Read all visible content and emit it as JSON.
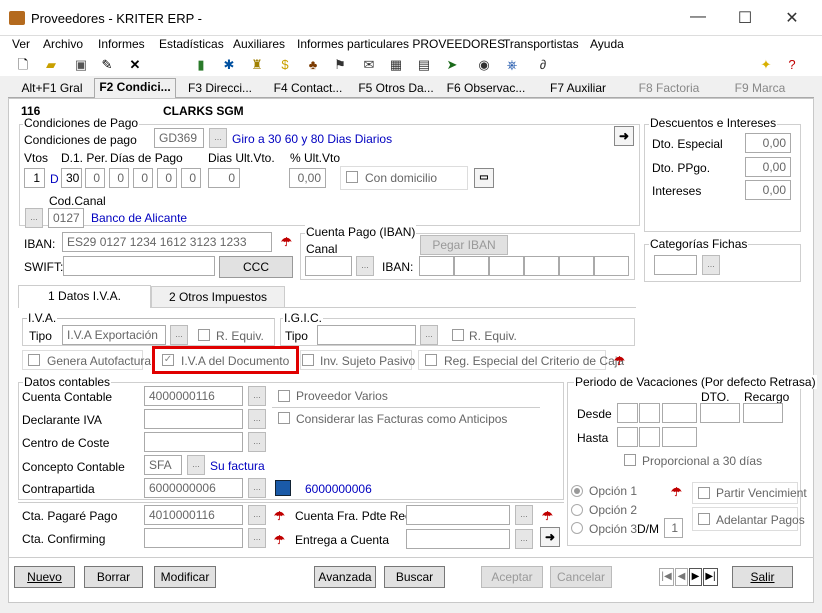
{
  "window": {
    "title": "Proveedores - KRITER ERP -"
  },
  "menu": [
    "Ver",
    "Archivo",
    "Informes",
    "Estadísticas",
    "Auxiliares",
    "Informes particulares PROVEEDORES",
    "Transportistas",
    "Ayuda"
  ],
  "tabs": [
    "Alt+F1 Gral",
    "F2 Condici...",
    "F3 Direcci...",
    "F4 Contact...",
    "F5 Otros Da...",
    "F6 Observac...",
    "F7 Auxiliar",
    "F8 Factoria",
    "F9 Marca"
  ],
  "header": {
    "code": "116",
    "name": "CLARKS SGM"
  },
  "condiciones_pago": {
    "group": "Condiciones de Pago",
    "label": "Condiciones de pago",
    "code": "GD369",
    "desc": "Giro a 30 60 y 80 Dias Diarios",
    "vtos_label": "Vtos",
    "d1per_label": "D.1. Per.",
    "dias_pago_label": "Días de Pago",
    "dias_ult_label": "Dias Ult.Vto.",
    "pct_ult_label": "% Ult.Vto",
    "vtos": "1",
    "d_flag": "D",
    "d1per": "30",
    "dias": [
      "0",
      "0",
      "0",
      "0",
      "0"
    ],
    "dias_ult": "0",
    "pct_ult": "0,00",
    "con_domicilio": "Con domicilio",
    "cod_canal_label": "Cod.Canal",
    "cod_canal": "0127",
    "banco": "Banco de Alicante",
    "iban_label": "IBAN:",
    "iban": "ES29 0127 1234 1612 3123 1233",
    "swift_label": "SWIFT:",
    "ccc": "CCC"
  },
  "cuenta_pago": {
    "group": "Cuenta Pago (IBAN)",
    "pegar": "Pegar IBAN",
    "canal_label": "Canal",
    "iban_label": "IBAN:"
  },
  "descuentos": {
    "group": "Descuentos e Intereses",
    "especial_label": "Dto. Especial",
    "especial": "0,00",
    "ppgo_label": "Dto. PPgo.",
    "ppgo": "0,00",
    "intereses_label": "Intereses",
    "intereses": "0,00"
  },
  "categorias": {
    "group": "Categorías Fichas"
  },
  "subtabs": [
    "1 Datos I.V.A.",
    "2 Otros Impuestos"
  ],
  "iva": {
    "group": "I.V.A.",
    "tipo_label": "Tipo",
    "tipo": "I.V.A Exportación",
    "requiv": "R. Equiv.",
    "igic_group": "I.G.I.C.",
    "igic_tipo_label": "Tipo",
    "igic_requiv": "R. Equiv.",
    "genera": "Genera Autofactura",
    "iva_doc": "I.V.A del Documento",
    "inv_sujeto": "Inv. Sujeto Pasivo",
    "reg_especial": "Reg. Especial del Criterio de Caja"
  },
  "contables": {
    "group": "Datos contables",
    "cuenta_label": "Cuenta Contable",
    "cuenta": "4000000116",
    "proveedor_varios": "Proveedor Varios",
    "declarante_label": "Declarante IVA",
    "considerar": "Considerar las Facturas como Anticipos",
    "centro_label": "Centro de Coste",
    "concepto_label": "Concepto Contable",
    "concepto": "SFA",
    "concepto_desc": "Su factura",
    "contrapartida_label": "Contrapartida",
    "contrapartida": "6000000006",
    "contrapartida_desc": "6000000006",
    "pagare_label": "Cta. Pagaré Pago",
    "pagare": "4010000116",
    "fra_pdte_label": "Cuenta Fra. Pdte Rec.",
    "confirming_label": "Cta. Confirming",
    "entrega_label": "Entrega a Cuenta"
  },
  "vacaciones": {
    "group": "Periodo de Vacaciones (Por defecto Retrasa)",
    "dto": "DTO.",
    "recargo": "Recargo",
    "desde": "Desde",
    "hasta": "Hasta",
    "proporcional": "Proporcional a 30 días",
    "opcion1": "Opción 1",
    "opcion2": "Opción 2",
    "opcion3": "Opción 3",
    "dm_label": "D/M",
    "dm": "1",
    "partir": "Partir Vencimient",
    "adelantar": "Adelantar Pagos"
  },
  "buttons": {
    "nuevo": "Nuevo",
    "borrar": "Borrar",
    "modificar": "Modificar",
    "avanzada": "Avanzada",
    "buscar": "Buscar",
    "aceptar": "Aceptar",
    "cancelar": "Cancelar",
    "salir": "Salir"
  }
}
